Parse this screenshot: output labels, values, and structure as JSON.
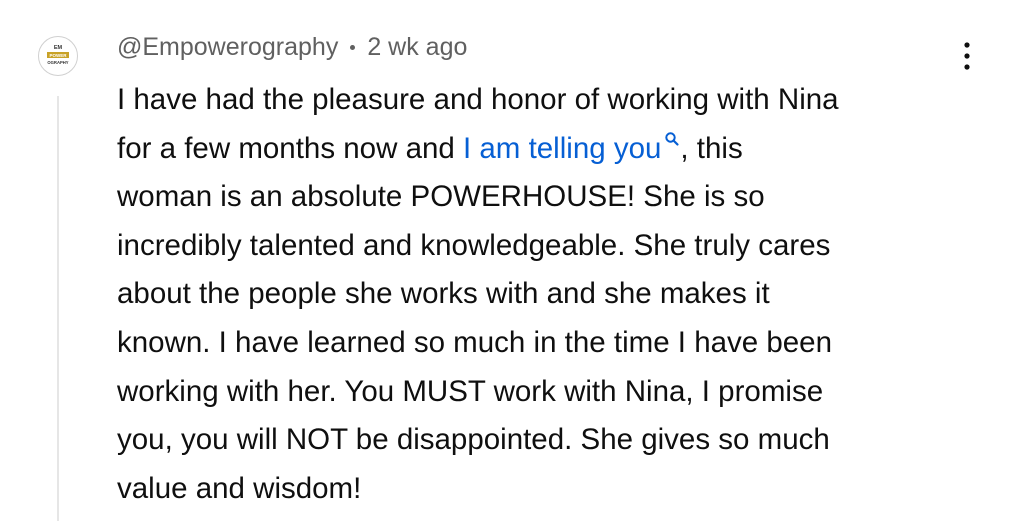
{
  "comment": {
    "author": "@Empowerography",
    "time": "2 wk ago",
    "avatar": {
      "line1": "EM",
      "line2": "POWER",
      "line3": "OGRAPHY",
      "accent": "#c9a227"
    },
    "more_icon": "vertical-ellipsis-icon",
    "body": {
      "line1": "I have had the pleasure and honor of working with Nina",
      "line2_before": "for a few months now and ",
      "line2_link": "I am telling you",
      "line2_after": ", this",
      "line3": "woman is an absolute POWERHOUSE! She is so",
      "line4": "incredibly talented and knowledgeable. She truly cares",
      "line5": "about the people she works with and she makes it",
      "line6": "known. I have learned so much in the time I have been",
      "line7": "working with her. You MUST work with Nina, I promise",
      "line8": "you, you will NOT be disappointed. She gives so much",
      "line9": "value and wisdom!"
    },
    "link_color": "#065fd4",
    "link_icon": "search-icon"
  }
}
